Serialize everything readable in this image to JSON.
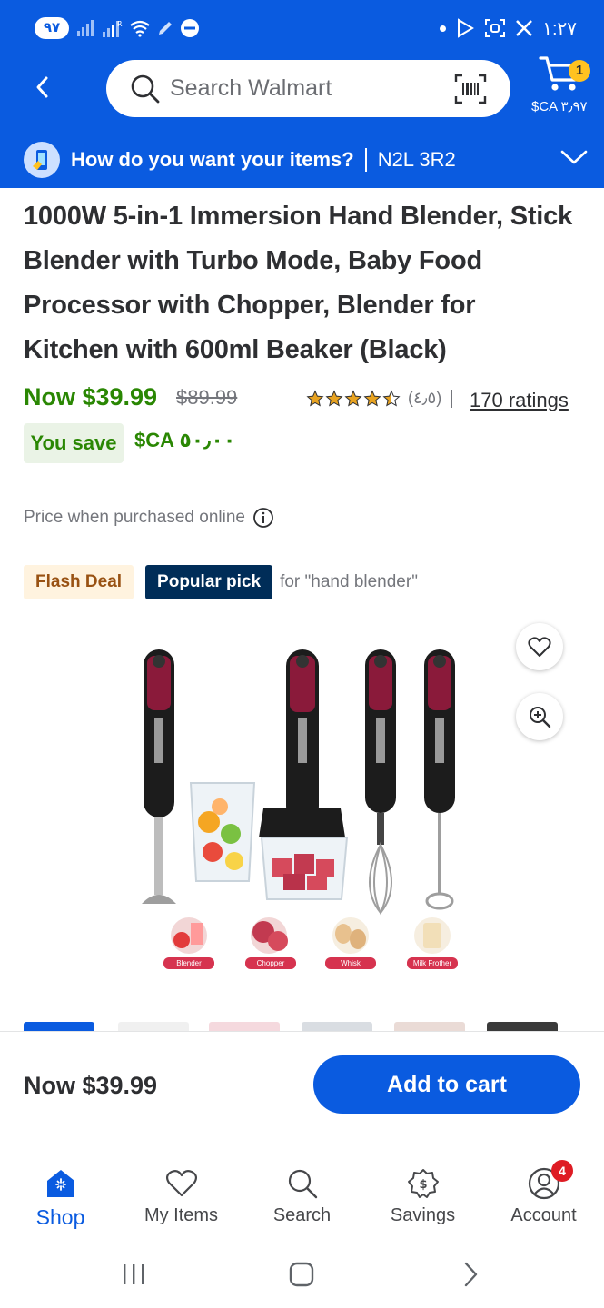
{
  "status_bar": {
    "badge": "٩٧",
    "time": "١:٢٧"
  },
  "header": {
    "search_placeholder": "Search Walmart",
    "cart_count": "1",
    "cart_total": "$CA ٣٫٩٧"
  },
  "delivery": {
    "question": "How do you want your items?",
    "postal_code": "N2L 3R2"
  },
  "product": {
    "title": "1000W 5-in-1 Immersion Hand Blender, Stick Blender with Turbo Mode, Baby Food Processor with Chopper, Blender for Kitchen with 600ml Beaker (Black)",
    "price_now": "Now $39.99",
    "price_was": "$89.99",
    "rating_value": "(٤٫٥)",
    "rating_stars": 4.5,
    "ratings_count": "170 ratings",
    "you_save_label": "You save",
    "you_save_amount": "$CA ٥٠٫٠٠",
    "price_note": "Price when purchased online",
    "badge_flash": "Flash Deal",
    "badge_popular": "Popular pick",
    "popular_context": "for \"hand blender\"",
    "image_labels": [
      "Blender",
      "Chopper",
      "Whisk",
      "Milk Frother"
    ]
  },
  "buy_bar": {
    "price": "Now $39.99",
    "add_to_cart": "Add to cart"
  },
  "tabs": [
    {
      "label": "Shop",
      "icon": "shop-icon"
    },
    {
      "label": "My Items",
      "icon": "heart-icon"
    },
    {
      "label": "Search",
      "icon": "search-icon"
    },
    {
      "label": "Savings",
      "icon": "savings-icon"
    },
    {
      "label": "Account",
      "icon": "account-icon",
      "badge": "4"
    }
  ],
  "colors": {
    "brand_blue": "#0a5be0",
    "price_green": "#2a8703",
    "spark_yellow": "#ffc220",
    "navy": "#002d58"
  }
}
